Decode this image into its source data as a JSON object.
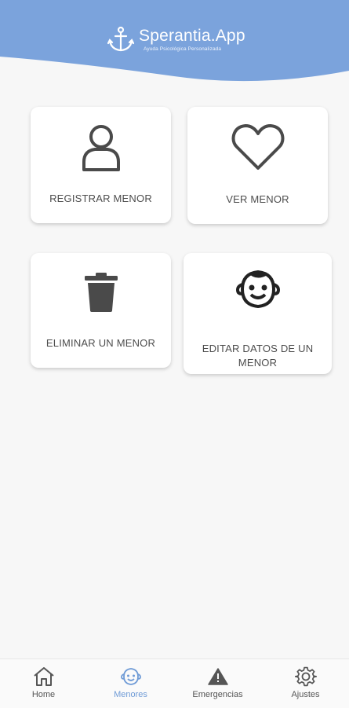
{
  "header": {
    "app_name": "Sperantia.App",
    "tagline": "Ayuda Psicológica Personalizada",
    "background_color": "#7ba3dc"
  },
  "cards": [
    {
      "label": "REGISTRAR MENOR",
      "icon": "person-icon"
    },
    {
      "label": "VER MENOR",
      "icon": "heart-icon"
    },
    {
      "label": "ELIMINAR UN MENOR",
      "icon": "trash-icon"
    },
    {
      "label": "EDITAR DATOS DE UN MENOR",
      "icon": "baby-face-icon"
    }
  ],
  "bottom_nav": {
    "active_color": "#6f9bd6",
    "items": [
      {
        "label": "Home",
        "icon": "home-icon",
        "active": false
      },
      {
        "label": "Menores",
        "icon": "baby-face-icon",
        "active": true
      },
      {
        "label": "Emergencias",
        "icon": "warning-icon",
        "active": false
      },
      {
        "label": "Ajustes",
        "icon": "gear-icon",
        "active": false
      }
    ]
  }
}
